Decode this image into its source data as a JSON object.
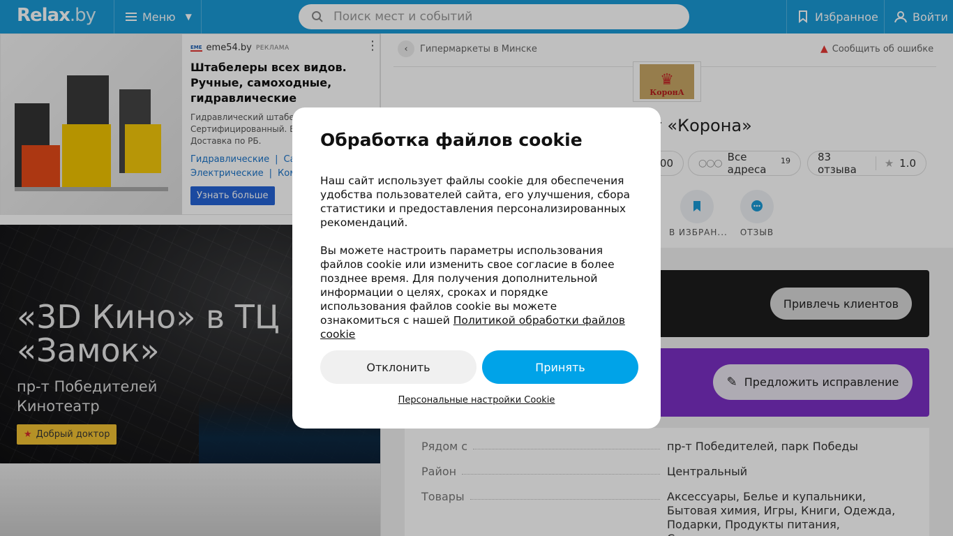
{
  "header": {
    "logo_main": "Relax",
    "logo_suffix": ".by",
    "menu_label": "Меню",
    "search_placeholder": "Поиск мест и событий",
    "favorites_label": "Избранное",
    "login_label": "Войти"
  },
  "ad": {
    "brand": "eme54.by",
    "brand_mark": "EME",
    "tag": "РЕКЛАМА",
    "title": "Штабелеры всех видов. Ручные, самоходные, гидравлические",
    "text_lines": [
      "Гидравлический штабел",
      "Сертифицированный. Вы",
      "Доставка по РБ."
    ],
    "links_row1": [
      "Гидравлические",
      "Са"
    ],
    "links_row2": [
      "Электрические",
      "Ком"
    ],
    "button": "Узнать больше"
  },
  "promo": {
    "title_line1": "«3D Кино» в ТЦ",
    "title_line2": "«Замок»",
    "sub_line1": "пр-т Победителей",
    "sub_line2": "Кинотеатр",
    "badge": "Добрый доктор"
  },
  "place": {
    "breadcrumb": "Гипермаркеты в Минске",
    "report": "Сообщить об ошибке",
    "logo_text": "КоронА",
    "title_visible": "ет «Корона»",
    "chip_phone_fragment": "00",
    "chip_addresses": "Все адреса",
    "chip_addresses_count": "19",
    "chip_reviews": "83 отзыва",
    "chip_rating": "1.0",
    "action_favorite": "В ИЗБРАН...",
    "action_review": "ОТЗЫВ",
    "attract_button": "Привлечь клиентов",
    "suggest_button": "Предложить исправление"
  },
  "info": [
    {
      "key": "Рядом с",
      "value": "пр-т Победителей, парк Победы"
    },
    {
      "key": "Район",
      "value": "Центральный"
    },
    {
      "key": "Товары",
      "value": "Аксессуары, Белье и купальники, Бытовая химия, Игры, Книги, Одежда, Подарки, Продукты питания, Спорттовары,..."
    }
  ],
  "cookie": {
    "title": "Обработка файлов cookie",
    "para1": "Наш сайт использует файлы cookie для обеспечения удобства пользователей сайта, его улучшения, сбора статистики и предоставления персонализированных рекомендаций.",
    "para2": "Вы можете настроить параметры использования файлов cookie или изменить свое согласие в более позднее время. Для получения дополнительной информации о целях, сроках и порядке использования файлов cookie вы можете ознакомиться с нашей",
    "policy_link": "Политикой обработки файлов cookie",
    "decline": "Отклонить",
    "accept": "Принять",
    "personal": "Персональные настройки Cookie"
  },
  "colors": {
    "header_bg": "#1a9ad6",
    "accept_bg": "#00a3e8",
    "purple_card": "#7b2fc4"
  },
  "icons": [
    "search-icon",
    "burger-icon",
    "chevron-down-icon",
    "bookmark-icon",
    "user-icon",
    "back-arrow-icon",
    "warning-icon",
    "star-icon",
    "pencil-icon",
    "comment-icon",
    "more-vertical-icon"
  ]
}
